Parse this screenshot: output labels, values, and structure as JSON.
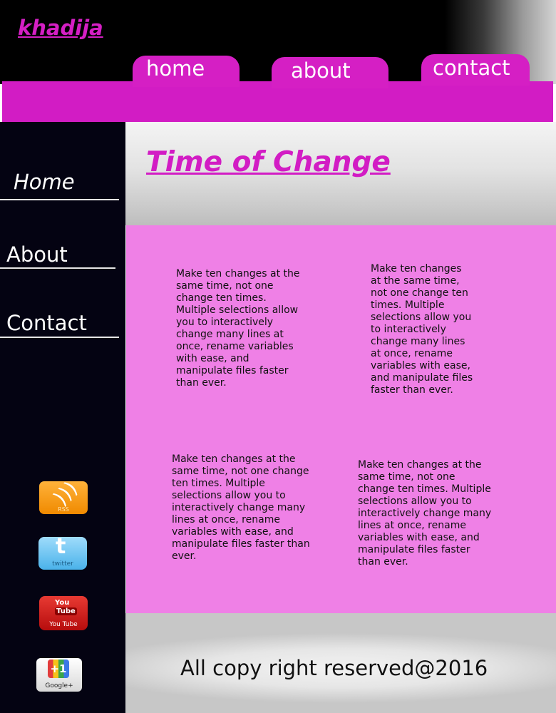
{
  "header": {
    "brand": "khadija",
    "tabs": [
      {
        "label": "home"
      },
      {
        "label": "about"
      },
      {
        "label": "contact"
      }
    ]
  },
  "sidebar": {
    "links": [
      {
        "label": "Home"
      },
      {
        "label": "About"
      },
      {
        "label": "Contact"
      }
    ],
    "social": {
      "rss": {
        "label": "RSS",
        "icon": "rss-icon"
      },
      "twitter": {
        "label": "twitter",
        "icon": "twitter-icon"
      },
      "youtube": {
        "label": "You Tube",
        "you": "You",
        "tube": "Tube",
        "icon": "youtube-icon"
      },
      "googleplus": {
        "label": "Google+",
        "plus": "+1",
        "icon": "google-plus-icon"
      }
    }
  },
  "main": {
    "title": "Time of Change",
    "paragraphs": [
      "Make ten changes at the same time, not one change ten times. Multiple selections allow you to interactively change many lines at once, rename variables with ease, and manipulate files faster than ever.",
      "Make ten changes at the same time, not one change ten times. Multiple selections allow you to interactively change many lines at once, rename variables with ease, and manipulate files faster than ever.",
      "Make ten changes at the same time, not one change ten times. Multiple selections allow you to interactively change many lines at once, rename variables with ease, and manipulate files faster than ever.",
      "Make ten changes at the same time, not one change ten times. Multiple selections allow you to interactively change many lines at once, rename variables with ease, and manipulate files faster than ever."
    ]
  },
  "footer": {
    "text": "All copy right reserved@2016"
  },
  "colors": {
    "accent": "#d21cc4",
    "content_bg": "#ef80e6",
    "sidebar_bg": "#040312",
    "header_bg": "#000000"
  }
}
